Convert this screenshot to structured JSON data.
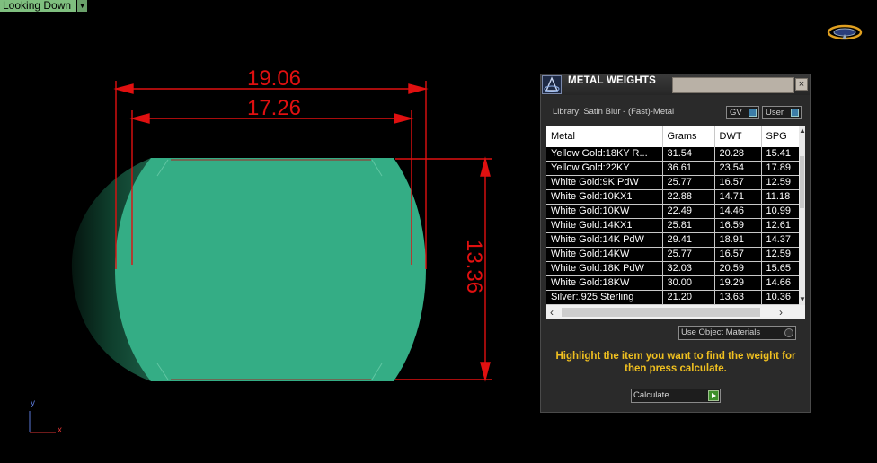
{
  "viewport": {
    "label": "Looking Down",
    "dimensions": {
      "outer_width": "19.06",
      "inner_width": "17.26",
      "height": "13.36"
    },
    "axes": {
      "y": "y",
      "x": "x"
    }
  },
  "panel": {
    "title": "METAL WEIGHTS",
    "close_label": "×",
    "library_label": "Library: Satin Blur - (Fast)-Metal",
    "toggle_gv": "GV",
    "toggle_user": "User",
    "columns": [
      "Metal",
      "Grams",
      "DWT",
      "SPG"
    ],
    "rows": [
      [
        "Yellow Gold:18KY R...",
        "31.54",
        "20.28",
        "15.41"
      ],
      [
        "Yellow Gold:22KY",
        "36.61",
        "23.54",
        "17.89"
      ],
      [
        "White Gold:9K PdW",
        "25.77",
        "16.57",
        "12.59"
      ],
      [
        "White Gold:10KX1",
        "22.88",
        "14.71",
        "11.18"
      ],
      [
        "White Gold:10KW",
        "22.49",
        "14.46",
        "10.99"
      ],
      [
        "White Gold:14KX1",
        "25.81",
        "16.59",
        "12.61"
      ],
      [
        "White Gold:14K PdW",
        "29.41",
        "18.91",
        "14.37"
      ],
      [
        "White Gold:14KW",
        "25.77",
        "16.57",
        "12.59"
      ],
      [
        "White Gold:18K PdW",
        "32.03",
        "20.59",
        "15.65"
      ],
      [
        "White Gold:18KW",
        "30.00",
        "19.29",
        "14.66"
      ],
      [
        "Silver:.925 Sterling",
        "21.20",
        "13.63",
        "10.36"
      ]
    ],
    "use_object_materials": "Use Object Materials",
    "instructions": "Highlight the item you want to find the weight for then press calculate.",
    "calculate_label": "Calculate"
  },
  "colors": {
    "model_fill": "#34ad85",
    "dimension": "#e01010",
    "instruction_text": "#f0c020"
  }
}
